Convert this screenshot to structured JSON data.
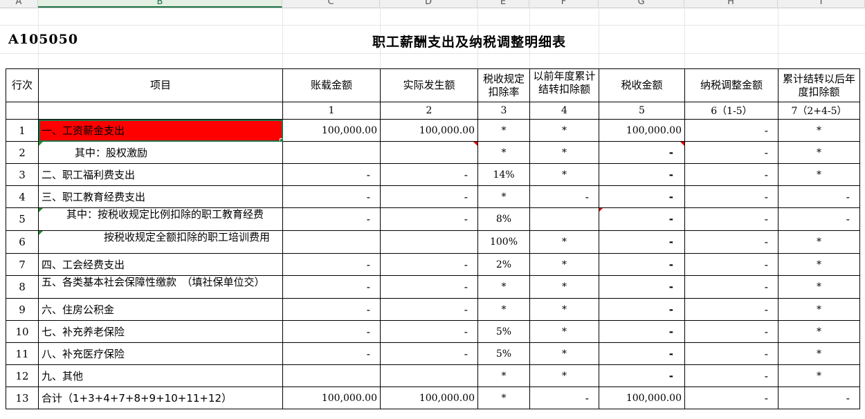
{
  "sheet": {
    "column_letters": [
      "A",
      "B",
      "C",
      "D",
      "E",
      "F",
      "G",
      "H",
      "I"
    ],
    "form_code": "A105050",
    "title": "职工薪酬支出及纳税调整明细表",
    "headers": {
      "row_no": "行次",
      "item": "项目",
      "book_amount": "账载金额",
      "actual_amount": "实际发生额",
      "deduction_rate": "税收规定扣除率",
      "prior_carryover": "以前年度累计结转扣除额",
      "tax_amount": "税收金额",
      "adjustment": "纳税调整金额",
      "cumulative_carryover": "累计结转以后年度扣除额"
    },
    "column_indices": [
      "1",
      "2",
      "3",
      "4",
      "5",
      "6（1-5）",
      "7（2+4-5）"
    ],
    "rows": [
      {
        "no": "1",
        "item": "一、工资薪金支出",
        "c": "100,000.00",
        "d": "100,000.00",
        "e": "*",
        "f": "*",
        "g": "100,000.00",
        "h": "-",
        "i": "*"
      },
      {
        "no": "2",
        "item": "其中：股权激励",
        "c": "",
        "d": "",
        "e": "*",
        "f": "*",
        "g": "-",
        "h": "-",
        "i": "*"
      },
      {
        "no": "3",
        "item": "二、职工福利费支出",
        "c": "-",
        "d": "-",
        "e": "14%",
        "f": "*",
        "g": "-",
        "h": "-",
        "i": "*"
      },
      {
        "no": "4",
        "item": "三、职工教育经费支出",
        "c": "-",
        "d": "-",
        "e": "*",
        "f": "-",
        "g": "-",
        "h": "-",
        "i": "-"
      },
      {
        "no": "5",
        "item": "其中：按税收规定比例扣除的职工教育经费",
        "c": "-",
        "d": "-",
        "e": "8%",
        "f": "",
        "g": "-",
        "h": "-",
        "i": "-"
      },
      {
        "no": "6",
        "item": "按税收规定全额扣除的职工培训费用",
        "c": "",
        "d": "",
        "e": "100%",
        "f": "*",
        "g": "-",
        "h": "-",
        "i": "*"
      },
      {
        "no": "7",
        "item": "四、工会经费支出",
        "c": "-",
        "d": "-",
        "e": "2%",
        "f": "*",
        "g": "-",
        "h": "-",
        "i": "*"
      },
      {
        "no": "8",
        "item": "五、各类基本社会保障性缴款　（填社保单位交）",
        "c": "-",
        "d": "-",
        "e": "*",
        "f": "*",
        "g": "-",
        "h": "-",
        "i": "*"
      },
      {
        "no": "9",
        "item": "六、住房公积金",
        "c": "-",
        "d": "-",
        "e": "*",
        "f": "*",
        "g": "-",
        "h": "-",
        "i": "*"
      },
      {
        "no": "10",
        "item": "七、补充养老保险",
        "c": "-",
        "d": "-",
        "e": "5%",
        "f": "*",
        "g": "-",
        "h": "-",
        "i": "*"
      },
      {
        "no": "11",
        "item": "八、补充医疗保险",
        "c": "-",
        "d": "-",
        "e": "5%",
        "f": "*",
        "g": "-",
        "h": "-",
        "i": "*"
      },
      {
        "no": "12",
        "item": "九、其他",
        "c": "",
        "d": "",
        "e": "*",
        "f": "*",
        "g": "-",
        "h": "-",
        "i": "*"
      },
      {
        "no": "13",
        "item": "合计（1+3+4+7+8+9+10+11+12）",
        "c": "100,000.00",
        "d": "100,000.00",
        "e": "*",
        "f": "-",
        "g": "100,000.00",
        "h": "-",
        "i": "-"
      }
    ]
  },
  "colors": {
    "selected_fill": "#ff0000",
    "selection_border": "#217346",
    "comment_marker": "#e00000"
  }
}
